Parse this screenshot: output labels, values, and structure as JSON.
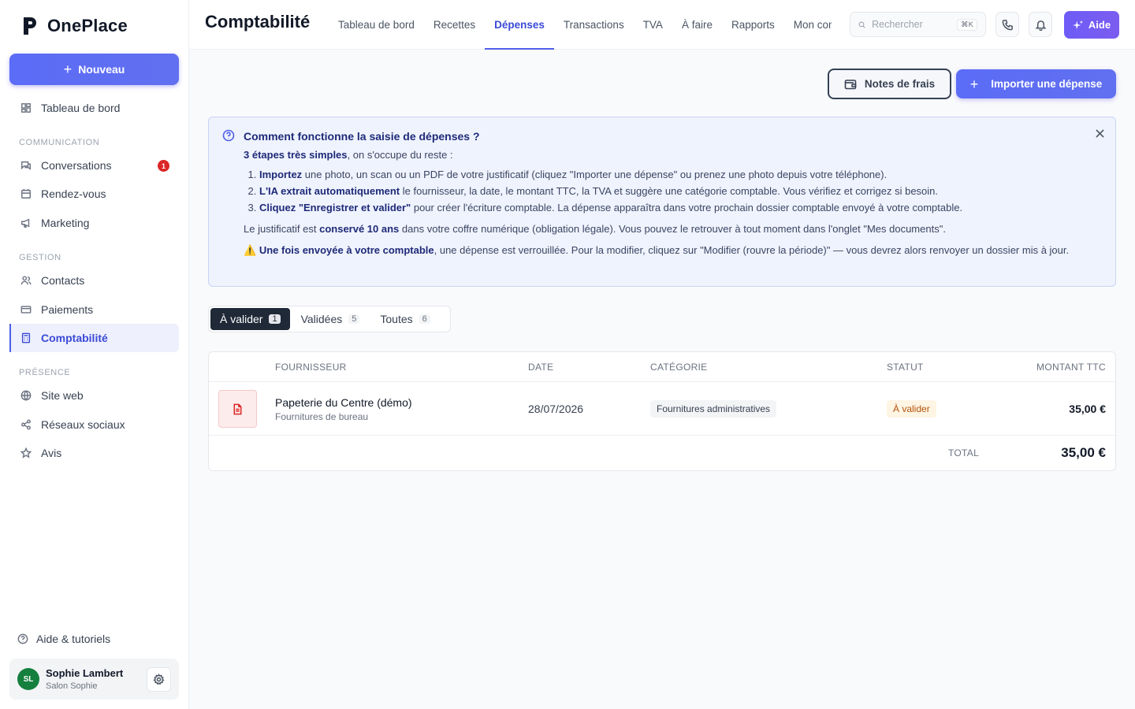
{
  "app": {
    "name": "OnePlace",
    "new_label": "Nouveau"
  },
  "sidebar": {
    "dashboard": "Tableau de bord",
    "sections": [
      {
        "label": "COMMUNICATION"
      },
      {
        "label": "GESTION"
      },
      {
        "label": "PRÉSENCE"
      }
    ],
    "items": [
      {
        "label": "Conversations",
        "badge": "1"
      },
      {
        "label": "Rendez-vous"
      },
      {
        "label": "Marketing"
      },
      {
        "label": "Contacts"
      },
      {
        "label": "Paiements"
      },
      {
        "label": "Comptabilité"
      },
      {
        "label": "Site web"
      },
      {
        "label": "Réseaux sociaux"
      },
      {
        "label": "Avis"
      }
    ],
    "help": "Aide & tutoriels",
    "user": {
      "initials": "SL",
      "name": "Sophie Lambert",
      "subtitle": "Salon Sophie"
    }
  },
  "header": {
    "title": "Comptabilité",
    "tabs": [
      {
        "label": "Tableau de bord"
      },
      {
        "label": "Recettes"
      },
      {
        "label": "Dépenses",
        "active": true
      },
      {
        "label": "Transactions"
      },
      {
        "label": "TVA"
      },
      {
        "label": "À faire"
      },
      {
        "label": "Rapports"
      },
      {
        "label": "Mon compte"
      }
    ],
    "search_placeholder": "Rechercher",
    "search_shortcut": "⌘K",
    "aide_label": "Aide"
  },
  "actions": {
    "expense_notes": "Notes de frais",
    "import_expense": "Importer une dépense"
  },
  "info": {
    "title": "Comment fonctionne la saisie de dépenses ?",
    "intro_bold": "3 étapes très simples",
    "intro_rest": ", on s'occupe du reste :",
    "steps": [
      {
        "bold": "Importez",
        "rest": " une photo, un scan ou un PDF de votre justificatif (cliquez \"Importer une dépense\" ou prenez une photo depuis votre téléphone)."
      },
      {
        "bold": "L'IA extrait automatiquement",
        "rest": " le fournisseur, la date, le montant TTC, la TVA et suggère une catégorie comptable. Vous vérifiez et corrigez si besoin."
      },
      {
        "bold": "Cliquez \"Enregistrer et valider\"",
        "rest": " pour créer l'écriture comptable. La dépense apparaîtra dans votre prochain dossier comptable envoyé à votre comptable."
      }
    ],
    "retention_pre": "Le justificatif est ",
    "retention_bold": "conservé 10 ans",
    "retention_post": " dans votre coffre numérique (obligation légale). Vous pouvez le retrouver à tout moment dans l'onglet \"Mes documents\".",
    "warn_icon": "⚠️",
    "warn_bold": "Une fois envoyée à votre comptable",
    "warn_rest": ", une dépense est verrouillée. Pour la modifier, cliquez sur \"Modifier (rouvre la période)\" — vous devrez alors renvoyer un dossier mis à jour."
  },
  "filters": [
    {
      "label": "À valider",
      "count": "1",
      "active": true
    },
    {
      "label": "Validées",
      "count": "5"
    },
    {
      "label": "Toutes",
      "count": "6"
    }
  ],
  "table": {
    "columns": [
      "FOURNISSEUR",
      "DATE",
      "CATÉGORIE",
      "STATUT",
      "MONTANT TTC"
    ],
    "rows": [
      {
        "supplier": "Papeterie du Centre (démo)",
        "supplier_sub": "Fournitures de bureau",
        "date": "28/07/2026",
        "category": "Fournitures administratives",
        "status": "À valider",
        "amount": "35,00 €"
      }
    ],
    "total_label": "TOTAL",
    "total_value": "35,00 €"
  }
}
